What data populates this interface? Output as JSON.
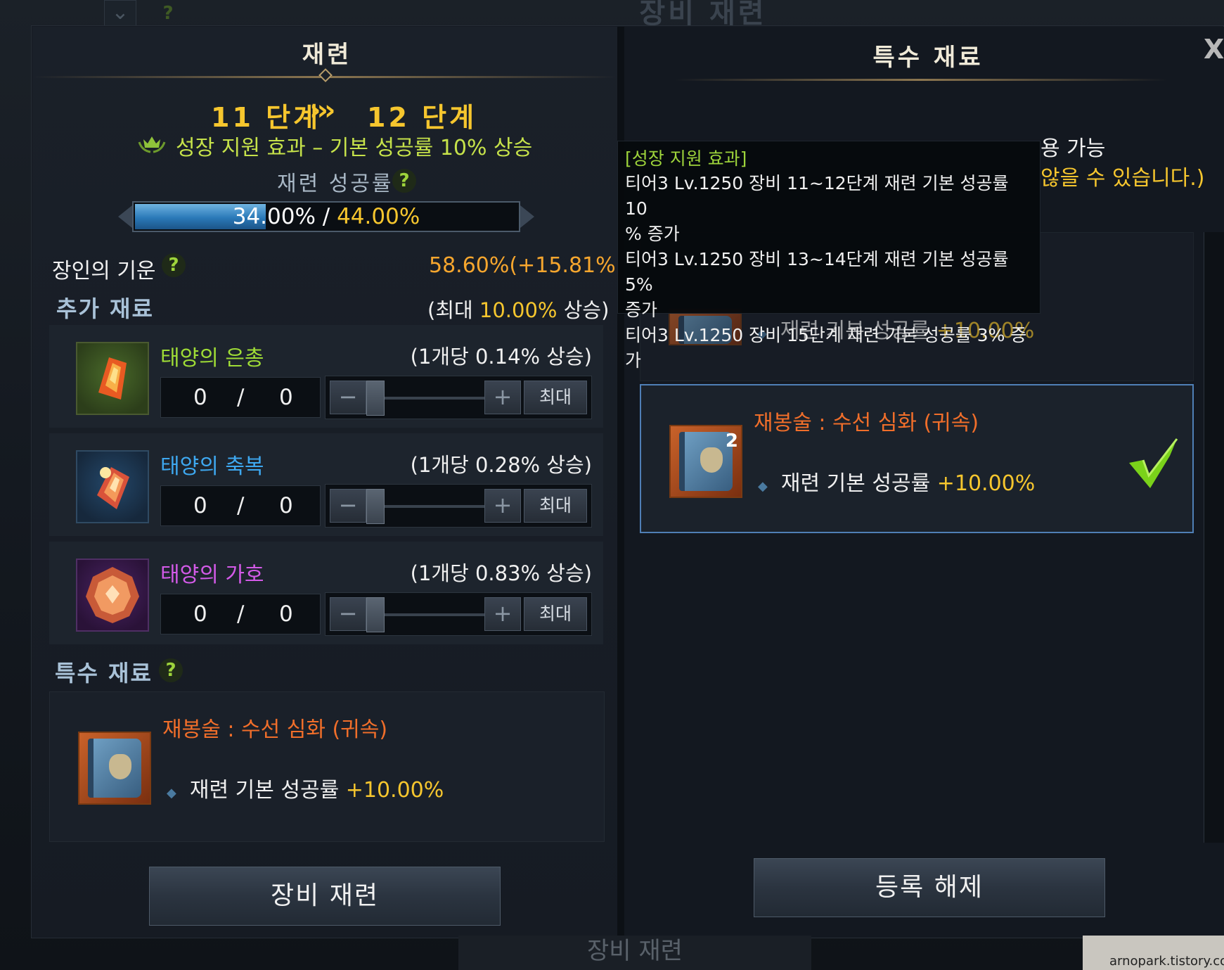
{
  "background": {
    "window_title": "장비 재련",
    "bottom_button": "장비 재련",
    "watermark": "arnopark.tistory.com"
  },
  "left": {
    "tab_title": "재련",
    "stage_from": "11 단계",
    "stage_arrows": "›››",
    "stage_to": "12 단계",
    "growth_effect": "성장 지원 효과 – 기본 성공률 10% 상승",
    "rate_label": "재련 성공률",
    "help": "?",
    "rate_current": "34.00%",
    "rate_separator": " / ",
    "rate_max": "44.00%",
    "rate_fill_fraction": 0.34,
    "artisan_label": "장인의 기운",
    "artisan_value": "58.60%(+15.81%)",
    "additional_title": "추가 재료",
    "additional_note_prefix": "(최대 ",
    "additional_note_value": "10.00%",
    "additional_note_suffix": " 상승)",
    "materials": [
      {
        "name": "태양의 은총",
        "desc": "(1개당 0.14% 상승)",
        "qty": "0",
        "sep": "/",
        "owned": "0",
        "max_label": "최대",
        "minus": "−",
        "plus": "+",
        "name_color": "#9fdc36"
      },
      {
        "name": "태양의 축복",
        "desc": "(1개당 0.28% 상승)",
        "qty": "0",
        "sep": "/",
        "owned": "0",
        "max_label": "최대",
        "minus": "−",
        "plus": "+",
        "name_color": "#3ea8f0"
      },
      {
        "name": "태양의 가호",
        "desc": "(1개당 0.83% 상승)",
        "qty": "0",
        "sep": "/",
        "owned": "0",
        "max_label": "최대",
        "minus": "−",
        "plus": "+",
        "name_color": "#d35ae8"
      }
    ],
    "special_title": "특수 재료",
    "special_item": {
      "name": "재봉술 : 수선 심화 (귀속)",
      "effect_label": "재련 기본 성공률 ",
      "effect_value": "+10.00%"
    },
    "refine_button": "장비 재련"
  },
  "right": {
    "tab_title": "특수 재료",
    "close": "X",
    "notice_line1": "용 가능",
    "notice_line2": "않을 수 있습니다.)",
    "dim_card": {
      "effect_label": "재련 기본 성공률 ",
      "effect_value": "+10.00%"
    },
    "selected_card": {
      "name": "재봉술 : 수선 심화 (귀속)",
      "count": "2",
      "effect_label": "재련 기본 성공률 ",
      "effect_value": "+10.00%"
    },
    "unregister_button": "등록 해제"
  },
  "tooltip": {
    "header": "[성장 지원 효과]",
    "lines": [
      "티어3 Lv.1250 장비 11~12단계 재련 기본 성공률 10",
      "% 증가",
      "티어3 Lv.1250 장비 13~14단계 재련 기본 성공률 5%",
      "증가",
      "티어3 Lv.1250 장비 15단계 재련 기본 성공률 3% 증가"
    ]
  },
  "colors": {
    "gold": "#f6c62e",
    "green": "#9ed43b",
    "orange": "#f06e2a",
    "selected_border": "#4f7fb6"
  },
  "icons": {
    "stage_arrows": "triple-chevron-right-icon",
    "growth": "crown-wreath-icon",
    "help": "question-circle-icon",
    "check": "check-mark-icon",
    "close": "close-icon"
  }
}
